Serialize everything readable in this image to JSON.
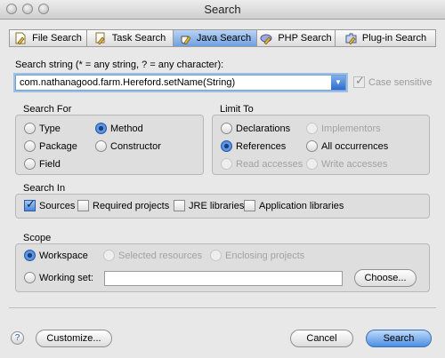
{
  "window": {
    "title": "Search"
  },
  "tabs": [
    {
      "label": "File Search",
      "icon": "file-search-icon",
      "selected": false
    },
    {
      "label": "Task Search",
      "icon": "task-search-icon",
      "selected": false
    },
    {
      "label": "Java Search",
      "icon": "java-search-icon",
      "selected": true
    },
    {
      "label": "PHP Search",
      "icon": "php-search-icon",
      "selected": false
    },
    {
      "label": "Plug-in Search",
      "icon": "plugin-search-icon",
      "selected": false
    }
  ],
  "search_string": {
    "label": "Search string (* = any string, ? = any character):",
    "value": "com.nathanagood.farm.Hereford.setName(String)"
  },
  "case_sensitive": {
    "label": "Case sensitive",
    "checked": true,
    "enabled": false
  },
  "search_for": {
    "title": "Search For",
    "options": {
      "type": "Type",
      "method": "Method",
      "package": "Package",
      "constructor": "Constructor",
      "field": "Field"
    },
    "selected": "Method"
  },
  "limit_to": {
    "title": "Limit To",
    "options": {
      "declarations": "Declarations",
      "implementors": "Implementors",
      "references": "References",
      "all_occurrences": "All occurrences",
      "read_accesses": "Read accesses",
      "write_accesses": "Write accesses"
    },
    "selected": "References"
  },
  "search_in": {
    "title": "Search In",
    "sources": "Sources",
    "required_projects": "Required projects",
    "jre_libraries": "JRE libraries",
    "application_libraries": "Application libraries"
  },
  "scope": {
    "title": "Scope",
    "workspace": "Workspace",
    "selected_resources": "Selected resources",
    "enclosing_projects": "Enclosing projects",
    "working_set": "Working set:",
    "working_set_value": "",
    "choose_button": "Choose..."
  },
  "footer": {
    "help": "?",
    "customize_button": "Customize...",
    "cancel_button": "Cancel",
    "search_button": "Search"
  },
  "colors": {
    "accent": "#3d7fe0",
    "window_bg": "#e8e8e8"
  }
}
